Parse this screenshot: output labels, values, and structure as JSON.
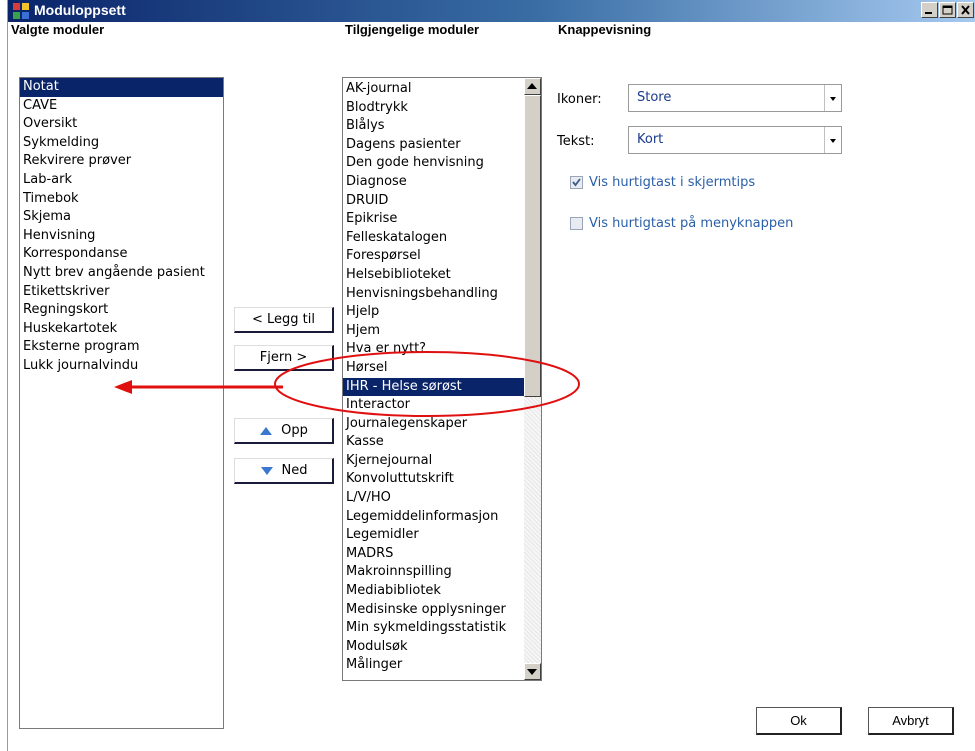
{
  "window": {
    "title": "Moduloppsett"
  },
  "headers": {
    "selected": "Valgte moduler",
    "available": "Tilgjengelige moduler",
    "button_display": "Knappevisning"
  },
  "selected_modules": [
    "Notat",
    "CAVE",
    "Oversikt",
    "Sykmelding",
    "Rekvirere prøver",
    "Lab-ark",
    "Timebok",
    "Skjema",
    "Henvisning",
    "Korrespondanse",
    "Nytt brev angående pasient",
    "Etikettskriver",
    "Regningskort",
    "Huskekartotek",
    "Eksterne program",
    "Lukk journalvindu"
  ],
  "selected_active_index": 0,
  "available_modules": [
    "AK-journal",
    "Blodtrykk",
    "Blålys",
    "Dagens pasienter",
    "Den gode henvisning",
    "Diagnose",
    "DRUID",
    "Epikrise",
    "Felleskatalogen",
    "Forespørsel",
    "Helsebiblioteket",
    "Henvisningsbehandling",
    "Hjelp",
    "Hjem",
    "Hva er nytt?",
    "Hørsel",
    "IHR - Helse sørøst",
    "Interactor",
    "Journalegenskaper",
    "Kasse",
    "Kjernejournal",
    "Konvoluttutskrift",
    "L/V/HO",
    "Legemiddelinformasjon",
    "Legemidler",
    "MADRS",
    "Makroinnspilling",
    "Mediabibliotek",
    "Medisinske opplysninger",
    "Min sykmeldingsstatistik",
    "Modulsøk",
    "Målinger"
  ],
  "available_active_index": 16,
  "buttons": {
    "add": "< Legg til",
    "remove": "Fjern >",
    "up": "Opp",
    "down": "Ned",
    "ok": "Ok",
    "cancel": "Avbryt"
  },
  "settings": {
    "icons_label": "Ikoner:",
    "icons_value": "Store",
    "text_label": "Tekst:",
    "text_value": "Kort",
    "show_shortcut_tooltip": {
      "label": "Vis hurtigtast i skjermtips",
      "checked": true
    },
    "show_shortcut_menu": {
      "label": "Vis hurtigtast på menyknappen",
      "checked": false
    }
  },
  "colors": {
    "selection": "#0a246a",
    "annotation": "#e01010",
    "setting_text": "#2a5fa8"
  },
  "icons": {
    "title": "app-grid-icon",
    "up": "arrow-up-icon",
    "down": "arrow-down-icon"
  }
}
